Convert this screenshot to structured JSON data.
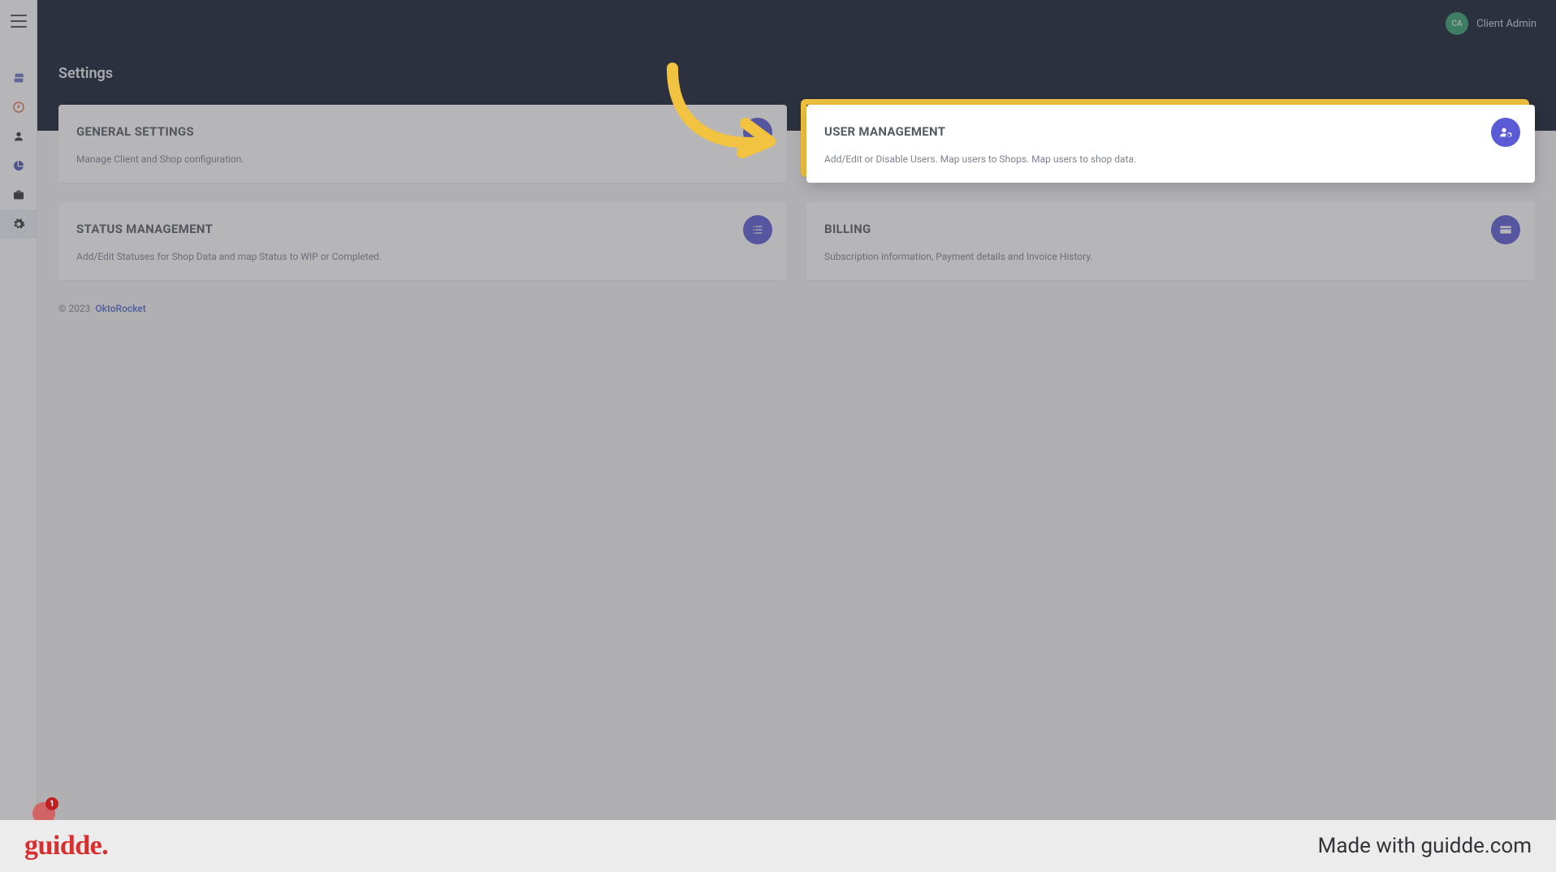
{
  "header": {
    "page_title": "Settings",
    "user": {
      "initials": "CA",
      "name": "Client Admin"
    }
  },
  "sidebar": {
    "icons": [
      "menu",
      "store",
      "compass",
      "user",
      "chart-pie",
      "briefcase",
      "gear"
    ]
  },
  "cards": {
    "general": {
      "title": "GENERAL SETTINGS",
      "desc": "Manage Client and Shop configuration."
    },
    "users": {
      "title": "USER MANAGEMENT",
      "desc": "Add/Edit or Disable Users. Map users to Shops. Map users to shop data."
    },
    "status": {
      "title": "STATUS MANAGEMENT",
      "desc": "Add/Edit Statuses for Shop Data and map Status to WIP or Completed."
    },
    "billing": {
      "title": "BILLING",
      "desc": "Subscription information, Payment details and Invoice History."
    }
  },
  "footer": {
    "copyright": "© 2023",
    "brand": "OktoRocket"
  },
  "banner": {
    "logo": "guidde.",
    "made": "Made with guidde.com"
  },
  "notif": {
    "count": "1"
  },
  "highlight": {
    "target": "users"
  }
}
